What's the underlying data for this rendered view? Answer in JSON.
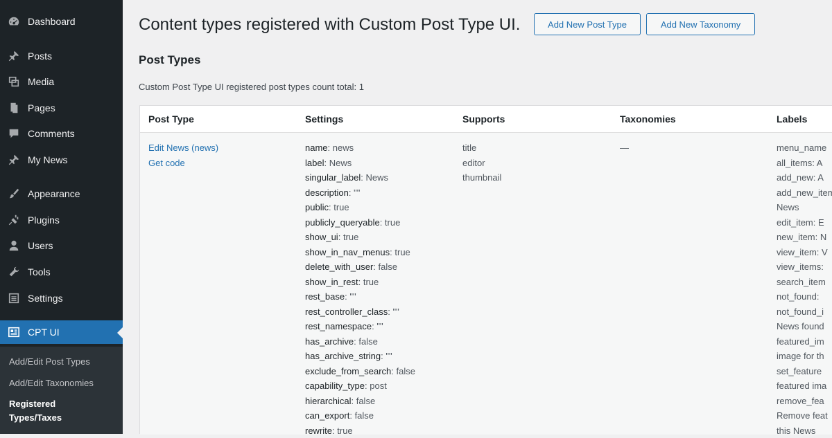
{
  "sidebar": {
    "items": [
      {
        "label": "Dashboard",
        "icon": "dashboard-icon"
      },
      {
        "label": "Posts",
        "icon": "pin-icon"
      },
      {
        "label": "Media",
        "icon": "media-icon"
      },
      {
        "label": "Pages",
        "icon": "pages-icon"
      },
      {
        "label": "Comments",
        "icon": "comment-icon"
      },
      {
        "label": "My News",
        "icon": "pin-icon"
      },
      {
        "label": "Appearance",
        "icon": "brush-icon"
      },
      {
        "label": "Plugins",
        "icon": "plug-icon"
      },
      {
        "label": "Users",
        "icon": "user-icon"
      },
      {
        "label": "Tools",
        "icon": "wrench-icon"
      },
      {
        "label": "Settings",
        "icon": "settings-icon"
      },
      {
        "label": "CPT UI",
        "icon": "cptui-icon"
      }
    ],
    "submenu": [
      {
        "label": "Add/Edit Post Types"
      },
      {
        "label": "Add/Edit Taxonomies"
      },
      {
        "label": "Registered Types/Taxes"
      }
    ]
  },
  "header": {
    "title": "Content types registered with Custom Post Type UI.",
    "add_post_type": "Add New Post Type",
    "add_taxonomy": "Add New Taxonomy"
  },
  "section": {
    "title": "Post Types",
    "count_text": "Custom Post Type UI registered post types count total: 1"
  },
  "table": {
    "columns": [
      "Post Type",
      "Settings",
      "Supports",
      "Taxonomies",
      "Labels"
    ],
    "row": {
      "post_type_links": [
        "Edit News (news)",
        "Get code"
      ],
      "settings": [
        {
          "key": "name",
          "value": "news"
        },
        {
          "key": "label",
          "value": "News"
        },
        {
          "key": "singular_label",
          "value": "News"
        },
        {
          "key": "description",
          "value": "\"\""
        },
        {
          "key": "public",
          "value": "true"
        },
        {
          "key": "publicly_queryable",
          "value": "true"
        },
        {
          "key": "show_ui",
          "value": "true"
        },
        {
          "key": "show_in_nav_menus",
          "value": "true"
        },
        {
          "key": "delete_with_user",
          "value": "false"
        },
        {
          "key": "show_in_rest",
          "value": "true"
        },
        {
          "key": "rest_base",
          "value": "\"\""
        },
        {
          "key": "rest_controller_class",
          "value": "\"\""
        },
        {
          "key": "rest_namespace",
          "value": "\"\""
        },
        {
          "key": "has_archive",
          "value": "false"
        },
        {
          "key": "has_archive_string",
          "value": "\"\""
        },
        {
          "key": "exclude_from_search",
          "value": "false"
        },
        {
          "key": "capability_type",
          "value": "post"
        },
        {
          "key": "hierarchical",
          "value": "false"
        },
        {
          "key": "can_export",
          "value": "false"
        },
        {
          "key": "rewrite",
          "value": "true"
        }
      ],
      "supports": [
        "title",
        "editor",
        "thumbnail"
      ],
      "taxonomies": "—",
      "labels": [
        "menu_name",
        "all_items: A",
        "add_new: A",
        "add_new_item",
        "News",
        "edit_item: E",
        "new_item: N",
        "view_item: V",
        "view_items:",
        "search_item",
        "not_found:",
        "not_found_i",
        "News found",
        "featured_im",
        "image for th",
        "set_feature",
        "featured ima",
        "remove_fea",
        "Remove feat",
        "this News"
      ]
    }
  }
}
